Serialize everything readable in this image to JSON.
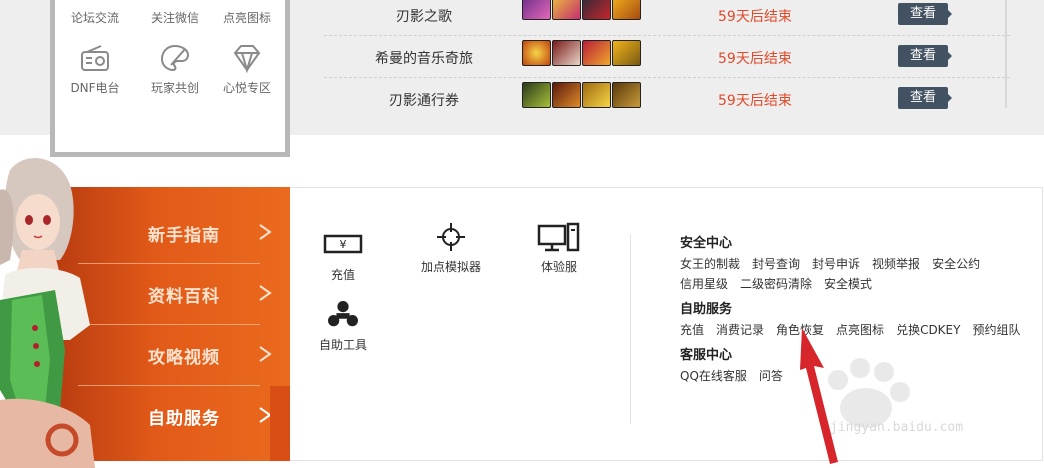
{
  "links_panel": {
    "row1": [
      {
        "label": "论坛交流",
        "icon": "forum-icon"
      },
      {
        "label": "关注微信",
        "icon": "wechat-icon"
      },
      {
        "label": "点亮图标",
        "icon": "light-icon"
      }
    ],
    "row2": [
      {
        "label": "DNF电台",
        "icon": "radio-icon"
      },
      {
        "label": "玩家共创",
        "icon": "palette-icon"
      },
      {
        "label": "心悦专区",
        "icon": "diamond-icon"
      }
    ]
  },
  "events": [
    {
      "name": "刃影之歌",
      "status": "59天后结束",
      "button": "查看"
    },
    {
      "name": "希曼的音乐奇旅",
      "status": "59天后结束",
      "button": "查看"
    },
    {
      "name": "刃影通行券",
      "status": "59天后结束",
      "button": "查看"
    }
  ],
  "menu": [
    {
      "label": "新手指南"
    },
    {
      "label": "资料百科"
    },
    {
      "label": "攻略视频"
    },
    {
      "label": "自助服务",
      "active": true
    }
  ],
  "tools": [
    {
      "label": "充值",
      "icon": "recharge-icon"
    },
    {
      "label": "加点模拟器",
      "icon": "crosshair-icon"
    },
    {
      "label": "体验服",
      "icon": "computer-icon"
    },
    {
      "label": "自助工具",
      "icon": "tools-icon"
    }
  ],
  "services": {
    "security": {
      "title": "安全中心",
      "links": [
        "女王的制裁",
        "封号查询",
        "封号申诉",
        "视频举报",
        "安全公约",
        "信用星级",
        "二级密码清除",
        "安全模式"
      ]
    },
    "self_service": {
      "title": "自助服务",
      "links": [
        "充值",
        "消费记录",
        "角色恢复",
        "点亮图标",
        "兑换CDKEY",
        "预约组队"
      ]
    },
    "support": {
      "title": "客服中心",
      "links": [
        "QQ在线客服",
        "问答"
      ]
    }
  },
  "watermark": {
    "text": "jingyan.baidu.com"
  },
  "colors": {
    "accent_orange": "#e25a18",
    "status_red": "#e04a2a",
    "button_slate": "#435262",
    "annotation_red": "#d7262b"
  }
}
